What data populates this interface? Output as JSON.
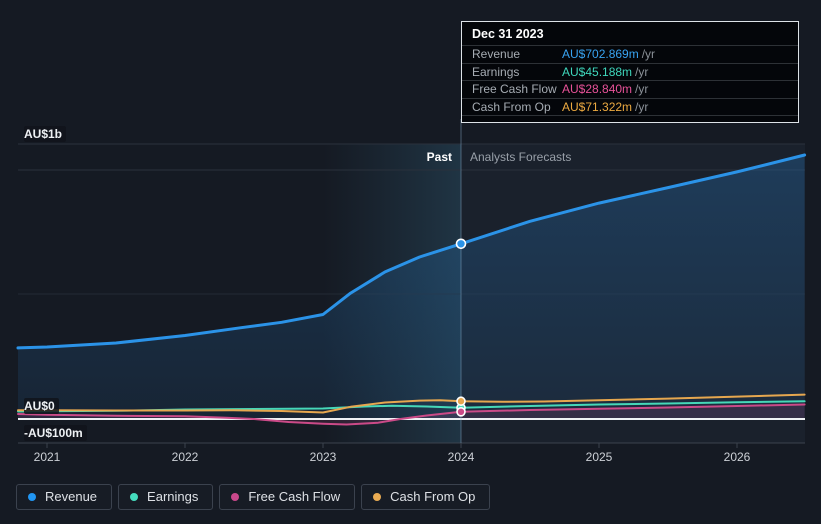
{
  "phase": {
    "past_label": "Past",
    "forecast_label": "Analysts Forecasts"
  },
  "tooltip": {
    "title": "Dec 31 2023",
    "rows": [
      {
        "label": "Revenue",
        "value": "AU$702.869m",
        "suffix": "/yr",
        "color": "#38a3f1"
      },
      {
        "label": "Earnings",
        "value": "AU$45.188m",
        "suffix": "/yr",
        "color": "#3fd7bc"
      },
      {
        "label": "Free Cash Flow",
        "value": "AU$28.840m",
        "suffix": "/yr",
        "color": "#e85298"
      },
      {
        "label": "Cash From Op",
        "value": "AU$71.322m",
        "suffix": "/yr",
        "color": "#edaa41"
      }
    ]
  },
  "y_axis": {
    "labels": [
      "AU$1b",
      "AU$0",
      "-AU$100m"
    ]
  },
  "x_axis": {
    "labels": [
      "2021",
      "2022",
      "2023",
      "2024",
      "2025",
      "2026"
    ]
  },
  "legend": {
    "items": [
      {
        "label": "Revenue",
        "color": "#2196f3"
      },
      {
        "label": "Earnings",
        "color": "#45dcbe"
      },
      {
        "label": "Free Cash Flow",
        "color": "#c9488b"
      },
      {
        "label": "Cash From Op",
        "color": "#e9ab52"
      }
    ]
  },
  "chart_data": {
    "type": "line",
    "title": "Past and forecast financials, AU$ per year",
    "x_unit": "year",
    "y_unit": "AU$m",
    "ylim": [
      -100,
      1100
    ],
    "x_ticks": [
      2021,
      2022,
      2023,
      2024,
      2025,
      2026
    ],
    "y_gridline_values": [
      1000,
      500,
      0,
      -100
    ],
    "past_forecast_divider_x": 2024,
    "highlight_band_x": [
      2023,
      2024
    ],
    "legend_position": "bottom",
    "tooltip_point": {
      "date": "Dec 31 2023",
      "revenue_m": 702.869,
      "earnings_m": 45.188,
      "free_cash_flow_m": 28.84,
      "cash_from_op_m": 71.322
    },
    "series": [
      {
        "name": "Revenue",
        "color": "#2b93e8",
        "width": 3,
        "area": true,
        "marker_value": 702.869,
        "points": [
          [
            2020.79,
            285
          ],
          [
            2021,
            289
          ],
          [
            2021.5,
            305
          ],
          [
            2022,
            335
          ],
          [
            2022.4,
            366
          ],
          [
            2022.7,
            388
          ],
          [
            2023,
            419
          ],
          [
            2023.2,
            505
          ],
          [
            2023.45,
            590
          ],
          [
            2023.7,
            650
          ],
          [
            2024,
            702.869
          ],
          [
            2024.5,
            793
          ],
          [
            2025,
            866
          ],
          [
            2025.5,
            928
          ],
          [
            2026,
            991
          ],
          [
            2026.49,
            1059
          ]
        ]
      },
      {
        "name": "Earnings",
        "color": "#46d8b8",
        "width": 2,
        "area": false,
        "marker_value": 45.188,
        "points": [
          [
            2020.79,
            30
          ],
          [
            2021,
            31
          ],
          [
            2021.5,
            33
          ],
          [
            2022,
            38
          ],
          [
            2022.5,
            40
          ],
          [
            2023,
            42
          ],
          [
            2023.3,
            50
          ],
          [
            2023.5,
            53
          ],
          [
            2023.75,
            50
          ],
          [
            2024,
            45.188
          ],
          [
            2024.5,
            52
          ],
          [
            2025,
            58
          ],
          [
            2025.5,
            62
          ],
          [
            2026,
            67
          ],
          [
            2026.49,
            71
          ]
        ]
      },
      {
        "name": "Free Cash Flow",
        "color": "#cb4a88",
        "width": 2,
        "area": "negative",
        "marker_value": 28.84,
        "points": [
          [
            2020.79,
            20
          ],
          [
            2021,
            17
          ],
          [
            2021.5,
            13
          ],
          [
            2022,
            11
          ],
          [
            2022.3,
            5
          ],
          [
            2022.5,
            0
          ],
          [
            2022.75,
            -12
          ],
          [
            2023,
            -19
          ],
          [
            2023.17,
            -22
          ],
          [
            2023.4,
            -15
          ],
          [
            2023.56,
            0
          ],
          [
            2023.75,
            14
          ],
          [
            2024,
            28.84
          ],
          [
            2024.5,
            36
          ],
          [
            2025,
            41
          ],
          [
            2025.5,
            46
          ],
          [
            2026,
            52
          ],
          [
            2026.49,
            58
          ]
        ]
      },
      {
        "name": "Cash From Op",
        "color": "#e6a74f",
        "width": 2,
        "area": false,
        "marker_value": 71.322,
        "points": [
          [
            2020.79,
            35
          ],
          [
            2021,
            35
          ],
          [
            2021.5,
            34
          ],
          [
            2022,
            34
          ],
          [
            2022.35,
            35
          ],
          [
            2022.7,
            32
          ],
          [
            2023,
            26
          ],
          [
            2023.2,
            49
          ],
          [
            2023.45,
            66
          ],
          [
            2023.7,
            74
          ],
          [
            2023.85,
            75
          ],
          [
            2024,
            71.322
          ],
          [
            2024.3,
            69
          ],
          [
            2024.6,
            70
          ],
          [
            2025,
            75
          ],
          [
            2025.5,
            82
          ],
          [
            2026,
            90
          ],
          [
            2026.49,
            98
          ]
        ]
      }
    ]
  }
}
